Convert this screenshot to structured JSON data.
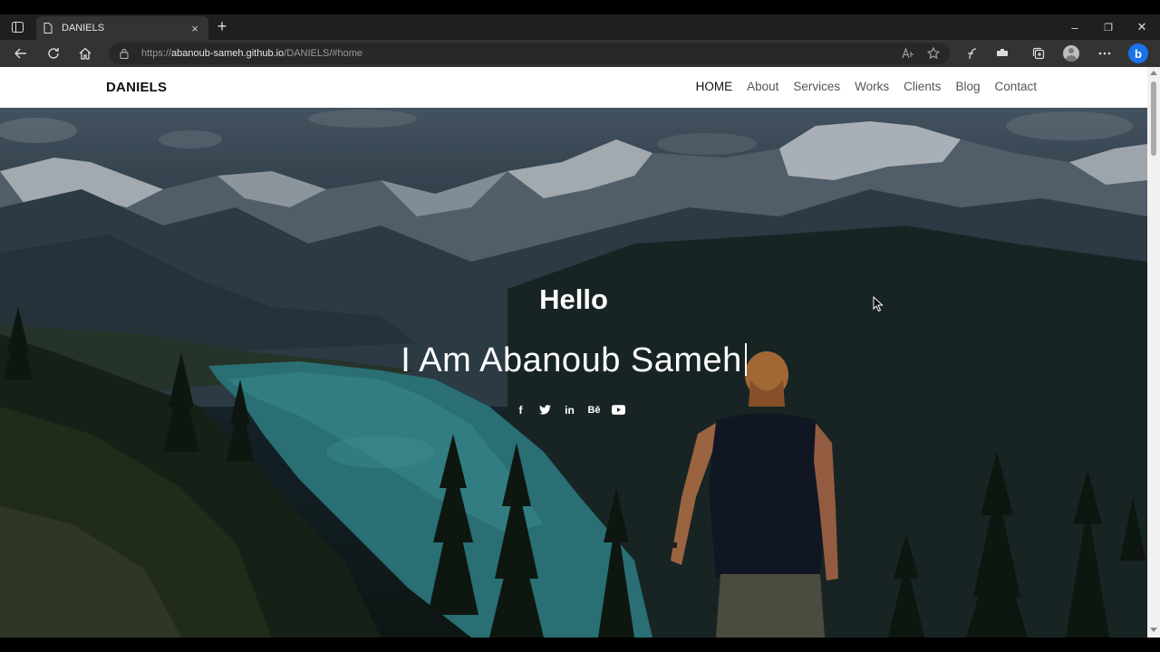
{
  "browser": {
    "tab_title": "DANIELS",
    "tab_close": "×",
    "new_tab": "+",
    "url_prefix": "https://",
    "url_host": "abanoub-sameh.github.io",
    "url_path": "/DANIELS/#home",
    "window_minimize": "–",
    "window_restore": "❐",
    "window_close": "✕",
    "bing_label": "b"
  },
  "site": {
    "logo": "DANIELS",
    "menu": [
      "HOME",
      "About",
      "Services",
      "Works",
      "Clients",
      "Blog",
      "Contact"
    ],
    "active_menu": "HOME"
  },
  "hero": {
    "greeting": "Hello",
    "tagline": "I Am Abanoub Sameh",
    "socials": [
      {
        "icon": "facebook-icon",
        "glyph": "f"
      },
      {
        "icon": "twitter-icon",
        "glyph": ""
      },
      {
        "icon": "linkedin-icon",
        "glyph": "in"
      },
      {
        "icon": "behance-icon",
        "glyph": "Bē"
      },
      {
        "icon": "youtube-icon",
        "glyph": ""
      }
    ]
  }
}
